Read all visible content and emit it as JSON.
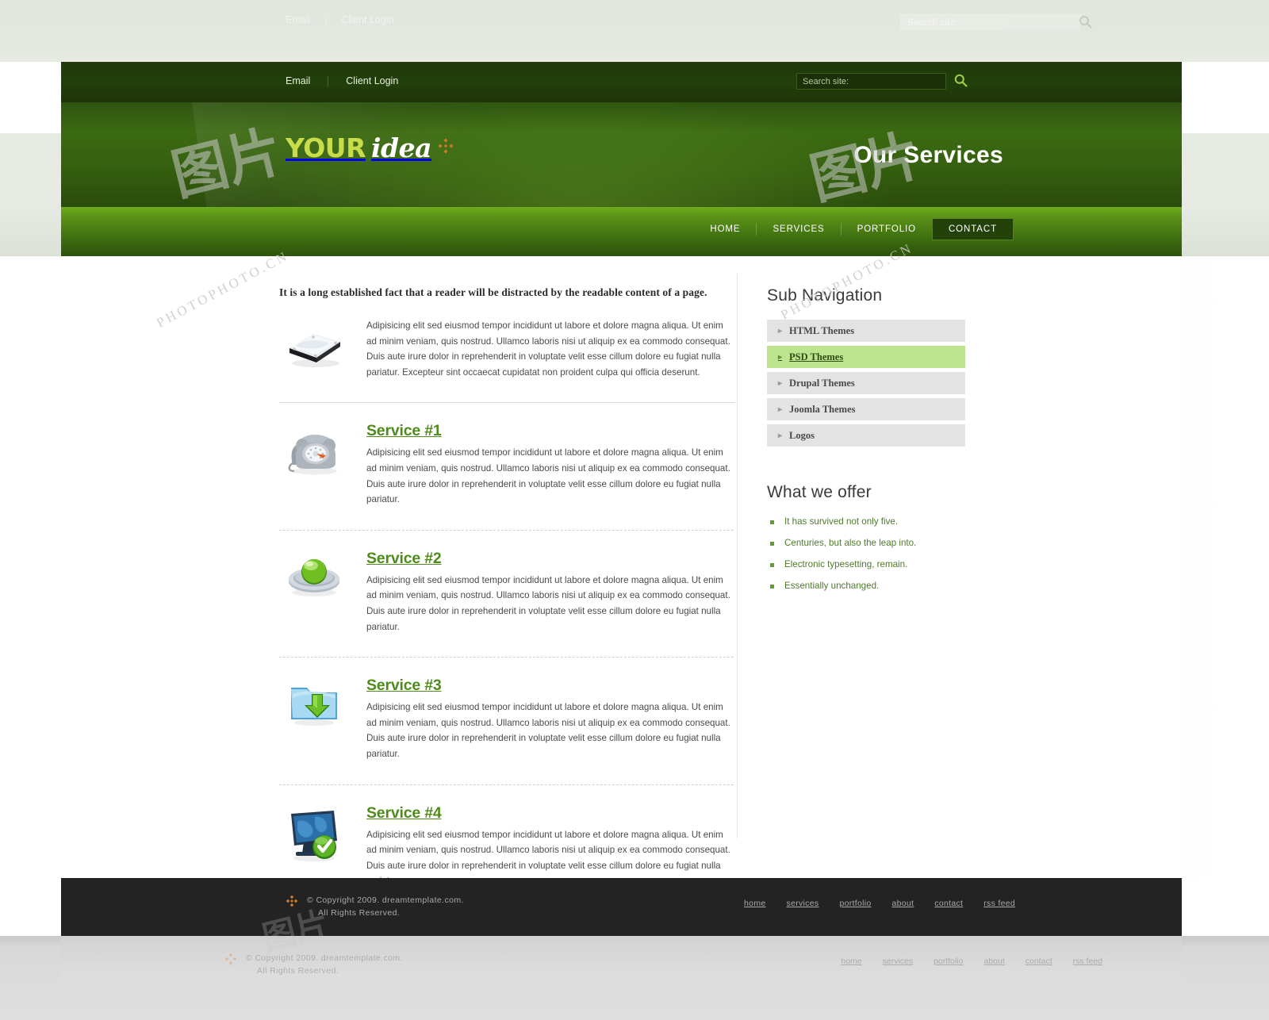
{
  "topbar": {
    "links": [
      {
        "label": "Email",
        "name": "email"
      },
      {
        "label": "Client Login",
        "name": "client-login"
      }
    ],
    "search": {
      "placeholder": "Search site:",
      "value": "",
      "icon": "search-icon"
    }
  },
  "brand": {
    "word1": "YOUR",
    "word2": "idea",
    "ornament": "diamond-ornament-icon",
    "colors": {
      "word1": "#c8dd4a",
      "word2": "#ffffff",
      "ornament": "#d4782a"
    }
  },
  "header": {
    "page_title": "Our Services"
  },
  "mainnav": {
    "items": [
      {
        "label": "HOME",
        "active": false
      },
      {
        "label": "SERVICES",
        "active": false
      },
      {
        "label": "PORTFOLIO",
        "active": false
      },
      {
        "label": "CONTACT",
        "active": true
      }
    ]
  },
  "main": {
    "intro_heading": "It is a long established fact that a reader will be distracted by the readable content of a page.",
    "intro_body": "Adipisicing elit sed eiusmod tempor incididunt ut labore et dolore magna aliqua. Ut enim ad minim veniam, quis nostrud. Ullamco laboris nisi ut aliquip ex ea commodo consequat. Duis aute irure dolor in reprehenderit in voluptate velit esse cillum dolore eu fugiat nulla pariatur. Excepteur sint occaecat cupidatat non proident culpa qui officia deserunt.",
    "intro_icon": "hard-drive-icon",
    "services": [
      {
        "title": "Service #1",
        "icon": "telephone-icon",
        "body": "Adipisicing elit sed eiusmod tempor incididunt ut labore et dolore magna aliqua. Ut enim ad minim veniam, quis nostrud. Ullamco laboris nisi ut aliquip ex ea commodo consequat. Duis aute irure dolor in reprehenderit in voluptate velit esse cillum dolore eu fugiat nulla pariatur."
      },
      {
        "title": "Service #2",
        "icon": "green-dome-icon",
        "body": "Adipisicing elit sed eiusmod tempor incididunt ut labore et dolore magna aliqua. Ut enim ad minim veniam, quis nostrud. Ullamco laboris nisi ut aliquip ex ea commodo consequat. Duis aute irure dolor in reprehenderit in voluptate velit esse cillum dolore eu fugiat nulla pariatur."
      },
      {
        "title": "Service #3",
        "icon": "download-folder-icon",
        "body": "Adipisicing elit sed eiusmod tempor incididunt ut labore et dolore magna aliqua. Ut enim ad minim veniam, quis nostrud. Ullamco laboris nisi ut aliquip ex ea commodo consequat. Duis aute irure dolor in reprehenderit in voluptate velit esse cillum dolore eu fugiat nulla pariatur."
      },
      {
        "title": "Service #4",
        "icon": "monitor-check-icon",
        "body": "Adipisicing elit sed eiusmod tempor incididunt ut labore et dolore magna aliqua. Ut enim ad minim veniam, quis nostrud. Ullamco laboris nisi ut aliquip ex ea commodo consequat. Duis aute irure dolor in reprehenderit in voluptate velit esse cillum dolore eu fugiat nulla pariatur."
      }
    ]
  },
  "sidebar": {
    "subnav_heading": "Sub Navigation",
    "subnav": [
      {
        "label": "HTML Themes",
        "active": false
      },
      {
        "label": "PSD Themes",
        "active": true
      },
      {
        "label": "Drupal Themes",
        "active": false
      },
      {
        "label": "Joomla Themes",
        "active": false
      },
      {
        "label": "Logos",
        "active": false
      }
    ],
    "offer_heading": "What we offer",
    "offer": [
      "It has survived not only five.",
      "Centuries, but also the leap into.",
      "Electronic typesetting, remain.",
      "Essentially unchanged."
    ]
  },
  "footer": {
    "ornament": "diamond-ornament-icon",
    "copyright_line1": "© Copyright 2009. dreamtemplate.com.",
    "copyright_line2": "All Rights Reserved.",
    "links": [
      "home",
      "services",
      "portfolio",
      "about",
      "contact",
      "rss feed"
    ]
  },
  "watermark": {
    "text": "PHOTOPHOTO.CN",
    "cjk": "图片"
  },
  "theme": {
    "dark_green": "#22400b",
    "mid_green": "#3c6a13",
    "nav_green": "#6fab1e",
    "accent_green": "#4e8b1a",
    "active_subnav": "#bde48e",
    "footer_dark": "#232323",
    "orange": "#d4782a"
  }
}
